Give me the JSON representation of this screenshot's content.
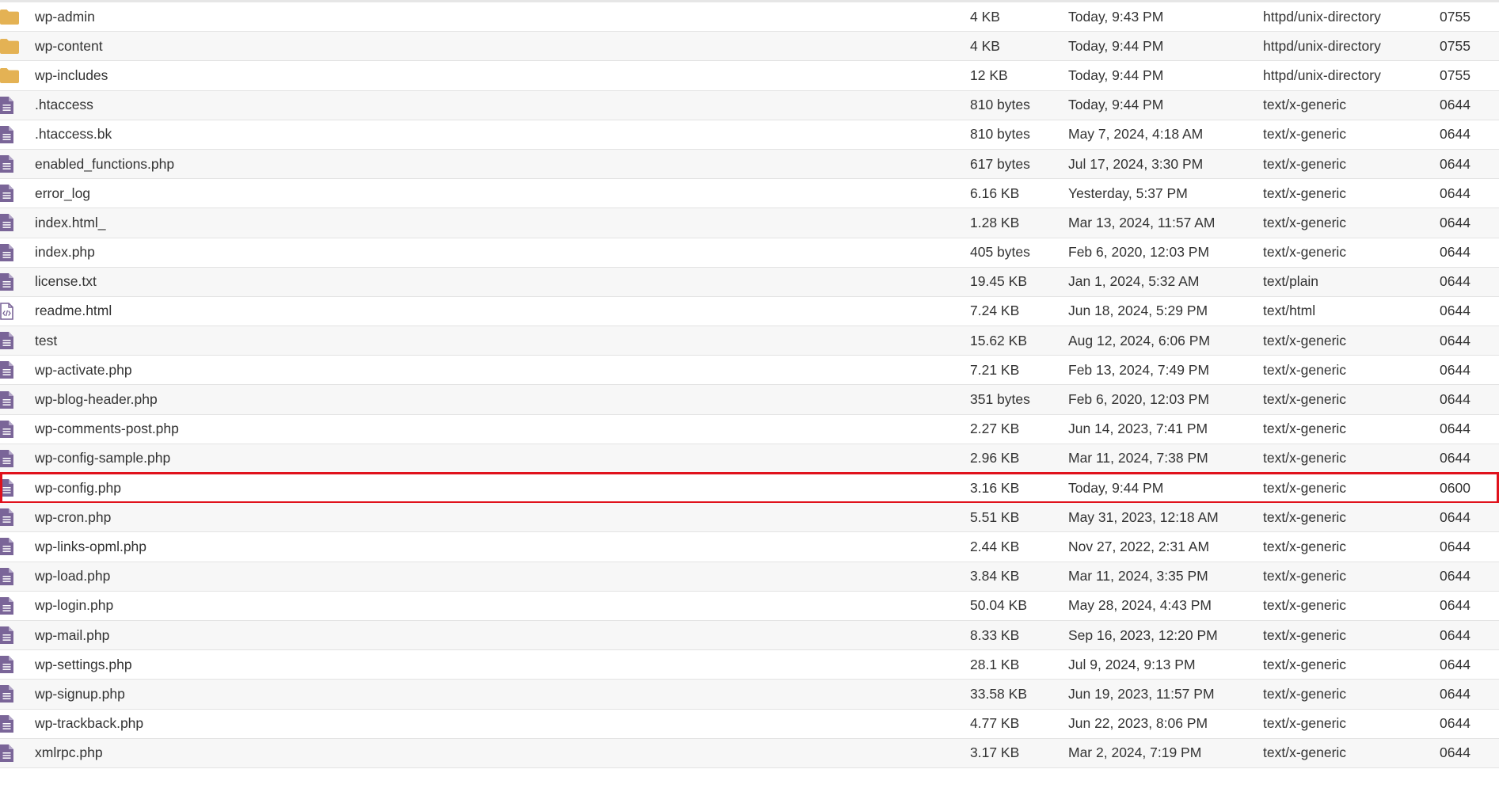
{
  "colors": {
    "folder": "#e4b254",
    "file": "#7a6598",
    "highlight_border": "#e0121c",
    "row_alt": "#f7f7f7"
  },
  "highlighted_row_index": 16,
  "files": [
    {
      "name": "wp-admin",
      "size": "4 KB",
      "modified": "Today, 9:43 PM",
      "type": "httpd/unix-directory",
      "perms": "0755",
      "icon": "folder-icon"
    },
    {
      "name": "wp-content",
      "size": "4 KB",
      "modified": "Today, 9:44 PM",
      "type": "httpd/unix-directory",
      "perms": "0755",
      "icon": "folder-icon"
    },
    {
      "name": "wp-includes",
      "size": "12 KB",
      "modified": "Today, 9:44 PM",
      "type": "httpd/unix-directory",
      "perms": "0755",
      "icon": "folder-icon"
    },
    {
      "name": ".htaccess",
      "size": "810 bytes",
      "modified": "Today, 9:44 PM",
      "type": "text/x-generic",
      "perms": "0644",
      "icon": "file-text-icon"
    },
    {
      "name": ".htaccess.bk",
      "size": "810 bytes",
      "modified": "May 7, 2024, 4:18 AM",
      "type": "text/x-generic",
      "perms": "0644",
      "icon": "file-text-icon"
    },
    {
      "name": "enabled_functions.php",
      "size": "617 bytes",
      "modified": "Jul 17, 2024, 3:30 PM",
      "type": "text/x-generic",
      "perms": "0644",
      "icon": "file-text-icon"
    },
    {
      "name": "error_log",
      "size": "6.16 KB",
      "modified": "Yesterday, 5:37 PM",
      "type": "text/x-generic",
      "perms": "0644",
      "icon": "file-text-icon"
    },
    {
      "name": "index.html_",
      "size": "1.28 KB",
      "modified": "Mar 13, 2024, 11:57 AM",
      "type": "text/x-generic",
      "perms": "0644",
      "icon": "file-text-icon"
    },
    {
      "name": "index.php",
      "size": "405 bytes",
      "modified": "Feb 6, 2020, 12:03 PM",
      "type": "text/x-generic",
      "perms": "0644",
      "icon": "file-text-icon"
    },
    {
      "name": "license.txt",
      "size": "19.45 KB",
      "modified": "Jan 1, 2024, 5:32 AM",
      "type": "text/plain",
      "perms": "0644",
      "icon": "file-text-icon"
    },
    {
      "name": "readme.html",
      "size": "7.24 KB",
      "modified": "Jun 18, 2024, 5:29 PM",
      "type": "text/html",
      "perms": "0644",
      "icon": "file-code-icon"
    },
    {
      "name": "test",
      "size": "15.62 KB",
      "modified": "Aug 12, 2024, 6:06 PM",
      "type": "text/x-generic",
      "perms": "0644",
      "icon": "file-text-icon"
    },
    {
      "name": "wp-activate.php",
      "size": "7.21 KB",
      "modified": "Feb 13, 2024, 7:49 PM",
      "type": "text/x-generic",
      "perms": "0644",
      "icon": "file-text-icon"
    },
    {
      "name": "wp-blog-header.php",
      "size": "351 bytes",
      "modified": "Feb 6, 2020, 12:03 PM",
      "type": "text/x-generic",
      "perms": "0644",
      "icon": "file-text-icon"
    },
    {
      "name": "wp-comments-post.php",
      "size": "2.27 KB",
      "modified": "Jun 14, 2023, 7:41 PM",
      "type": "text/x-generic",
      "perms": "0644",
      "icon": "file-text-icon"
    },
    {
      "name": "wp-config-sample.php",
      "size": "2.96 KB",
      "modified": "Mar 11, 2024, 7:38 PM",
      "type": "text/x-generic",
      "perms": "0644",
      "icon": "file-text-icon"
    },
    {
      "name": "wp-config.php",
      "size": "3.16 KB",
      "modified": "Today, 9:44 PM",
      "type": "text/x-generic",
      "perms": "0600",
      "icon": "file-text-icon"
    },
    {
      "name": "wp-cron.php",
      "size": "5.51 KB",
      "modified": "May 31, 2023, 12:18 AM",
      "type": "text/x-generic",
      "perms": "0644",
      "icon": "file-text-icon"
    },
    {
      "name": "wp-links-opml.php",
      "size": "2.44 KB",
      "modified": "Nov 27, 2022, 2:31 AM",
      "type": "text/x-generic",
      "perms": "0644",
      "icon": "file-text-icon"
    },
    {
      "name": "wp-load.php",
      "size": "3.84 KB",
      "modified": "Mar 11, 2024, 3:35 PM",
      "type": "text/x-generic",
      "perms": "0644",
      "icon": "file-text-icon"
    },
    {
      "name": "wp-login.php",
      "size": "50.04 KB",
      "modified": "May 28, 2024, 4:43 PM",
      "type": "text/x-generic",
      "perms": "0644",
      "icon": "file-text-icon"
    },
    {
      "name": "wp-mail.php",
      "size": "8.33 KB",
      "modified": "Sep 16, 2023, 12:20 PM",
      "type": "text/x-generic",
      "perms": "0644",
      "icon": "file-text-icon"
    },
    {
      "name": "wp-settings.php",
      "size": "28.1 KB",
      "modified": "Jul 9, 2024, 9:13 PM",
      "type": "text/x-generic",
      "perms": "0644",
      "icon": "file-text-icon"
    },
    {
      "name": "wp-signup.php",
      "size": "33.58 KB",
      "modified": "Jun 19, 2023, 11:57 PM",
      "type": "text/x-generic",
      "perms": "0644",
      "icon": "file-text-icon"
    },
    {
      "name": "wp-trackback.php",
      "size": "4.77 KB",
      "modified": "Jun 22, 2023, 8:06 PM",
      "type": "text/x-generic",
      "perms": "0644",
      "icon": "file-text-icon"
    },
    {
      "name": "xmlrpc.php",
      "size": "3.17 KB",
      "modified": "Mar 2, 2024, 7:19 PM",
      "type": "text/x-generic",
      "perms": "0644",
      "icon": "file-text-icon"
    }
  ]
}
